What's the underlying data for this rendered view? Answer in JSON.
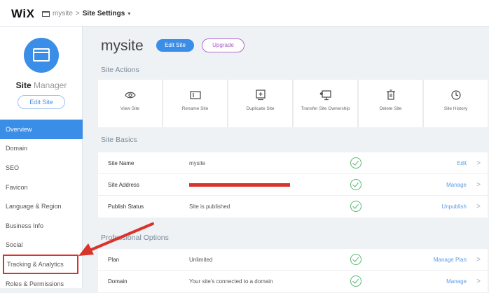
{
  "topbar": {
    "logo": "WiX",
    "crumb_site": "mysite",
    "crumb_sep": ">",
    "crumb_current": "Site Settings",
    "crumb_caret": "▾"
  },
  "sidebar": {
    "title_bold": "Site",
    "title_rest": " Manager",
    "edit_button": "Edit Site",
    "nav": [
      "Overview",
      "Domain",
      "SEO",
      "Favicon",
      "Language & Region",
      "Business Info",
      "Social",
      "Tracking & Analytics",
      "Roles & Permissions"
    ],
    "active_index": 0,
    "highlight_index": 7
  },
  "main": {
    "site_name": "mysite",
    "edit_site": "Edit Site",
    "upgrade": "Upgrade",
    "site_actions_heading": "Site Actions",
    "actions": [
      {
        "icon": "eye-icon",
        "label": "View Site"
      },
      {
        "icon": "rename-icon",
        "label": "Rename Site"
      },
      {
        "icon": "duplicate-icon",
        "label": "Duplicate Site"
      },
      {
        "icon": "transfer-icon",
        "label": "Transfer Site Ownership"
      },
      {
        "icon": "trash-icon",
        "label": "Delete Site"
      },
      {
        "icon": "history-icon",
        "label": "Site History"
      }
    ],
    "site_basics_heading": "Site Basics",
    "basics": [
      {
        "key": "Site Name",
        "value": "mysite",
        "action": "Edit"
      },
      {
        "key": "Site Address",
        "value": "",
        "action": "Manage"
      },
      {
        "key": "Publish Status",
        "value": "Site is published",
        "action": "Unpublish"
      }
    ],
    "professional_heading": "Professional Options",
    "professional": [
      {
        "key": "Plan",
        "value": "Unlimited",
        "action": "Manage Plan"
      },
      {
        "key": "Domain",
        "value": "Your site's connected to a domain",
        "action": "Manage"
      }
    ]
  },
  "colors": {
    "accent": "#3b8ee8",
    "highlight": "#d9342b",
    "ok": "#55b872",
    "upgrade": "#a65ec7"
  }
}
